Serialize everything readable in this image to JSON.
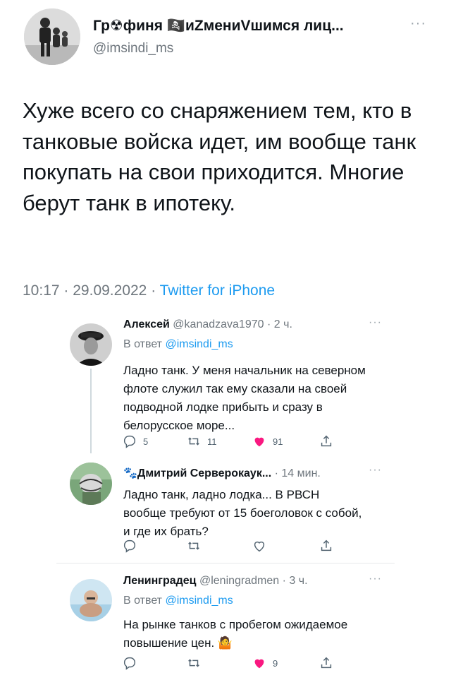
{
  "main_tweet": {
    "author_name": "Гр☢финя 🏴‍☠️иZмениVшимся лиц...",
    "author_handle": "@imsindi_ms",
    "text": "Хуже всего со снаряжением тем, кто в танковые войска идет, им вообще танк покупать на свои приходится. Многие берут танк в ипотеку.",
    "time": "10:17",
    "separator": "·",
    "date": "29.09.2022",
    "source": "Twitter for iPhone",
    "more": "···"
  },
  "replies": [
    {
      "name": "Алексей",
      "handle": "@kanadzava1970",
      "time": "· 2 ч.",
      "reply_to_label": "В ответ",
      "reply_to_handle": "@imsindi_ms",
      "text": "Ладно танк. У меня начальник на северном флоте служил так ему сказали на своей подводной лодке прибыть и сразу в белорусское море...",
      "replies_count": "5",
      "retweets_count": "11",
      "likes_count": "91",
      "liked": true
    },
    {
      "name_prefix_emoji": "🐾",
      "name": "Дмитрий Серверокаук...",
      "time": "· 14 мин.",
      "text": "Ладно танк, ладно лодка... В РВСН вообще требуют от 15 боеголовок с собой, и где их брать?",
      "liked": false
    },
    {
      "name": "Ленинградец",
      "handle": "@leningradmen",
      "time": "· 3 ч.",
      "reply_to_label": "В ответ",
      "reply_to_handle": "@imsindi_ms",
      "text": "На рынке танков с пробегом ожидаемое повышение цен.",
      "text_emoji": "🤷",
      "likes_count": "9",
      "liked": true
    }
  ],
  "colors": {
    "accent": "#1d9bf0",
    "like": "#f91880",
    "muted": "#6e767d",
    "divider": "#e6e8ea"
  }
}
